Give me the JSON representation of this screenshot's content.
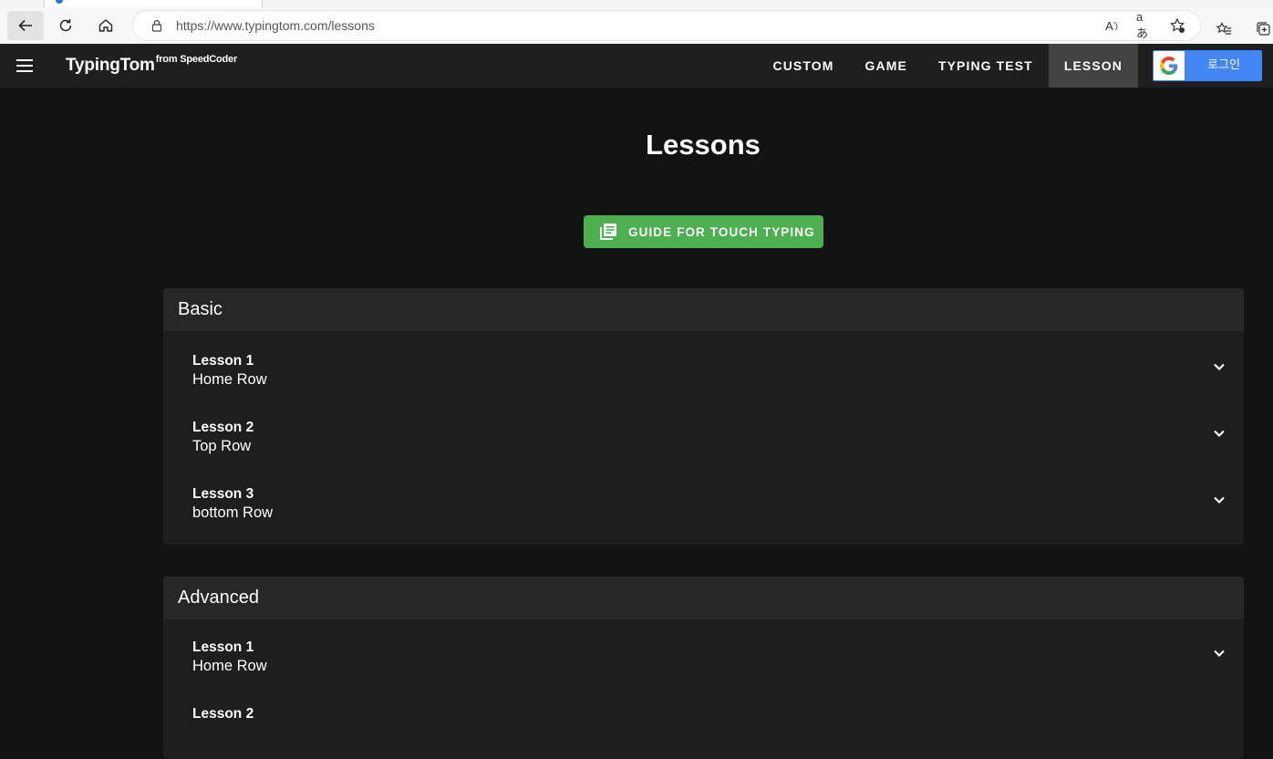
{
  "browser": {
    "url": "https://www.typingtom.com/lessons"
  },
  "app": {
    "brand": "TypingTom",
    "brand_sup": "from SpeedCoder",
    "nav": [
      "CUSTOM",
      "GAME",
      "TYPING TEST",
      "LESSON"
    ],
    "active_nav": "LESSON",
    "login_label": "로그인",
    "colors": {
      "appbar": "#1f1f1f",
      "active_nav": "#424242",
      "google_blue": "#4285f4",
      "guide_green": "#4caf50"
    }
  },
  "main": {
    "title": "Lessons",
    "guide_button": "GUIDE FOR TOUCH TYPING",
    "sections": [
      {
        "name": "Basic",
        "lessons": [
          {
            "number": "Lesson 1",
            "title": "Home Row"
          },
          {
            "number": "Lesson 2",
            "title": "Top Row"
          },
          {
            "number": "Lesson 3",
            "title": "bottom Row"
          }
        ]
      },
      {
        "name": "Advanced",
        "lessons": [
          {
            "number": "Lesson 1",
            "title": "Home Row"
          },
          {
            "number": "Lesson 2",
            "title": ""
          }
        ]
      }
    ]
  }
}
